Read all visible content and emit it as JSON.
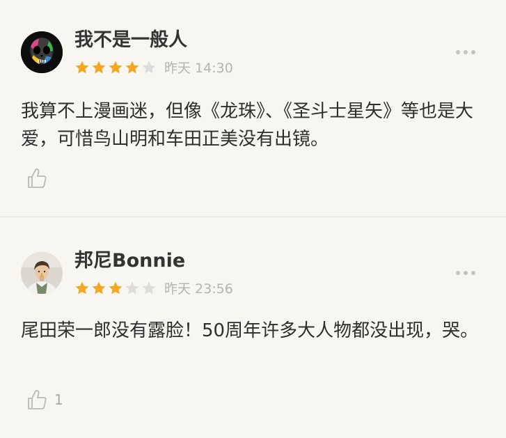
{
  "comments": [
    {
      "username": "我不是一般人",
      "rating": 4,
      "max_rating": 5,
      "timestamp": "昨天 14:30",
      "text": "我算不上漫画迷，但像《龙珠》、《圣斗士星矢》等也是大爱，可惜鸟山明和车田正美没有出镜。",
      "like_count": "",
      "avatar_icon": "skull-avatar-icon"
    },
    {
      "username": "邦尼Bonnie",
      "rating": 3,
      "max_rating": 5,
      "timestamp": "昨天 23:56",
      "text": "尾田荣一郎没有露脸！50周年许多大人物都没出现，哭。",
      "like_count": "1",
      "avatar_icon": "person-avatar-icon"
    }
  ],
  "colors": {
    "background": "#f7f6f0",
    "star_filled": "#f5a623",
    "star_empty": "#dcdcdc",
    "meta_text": "#b3b3b3"
  }
}
